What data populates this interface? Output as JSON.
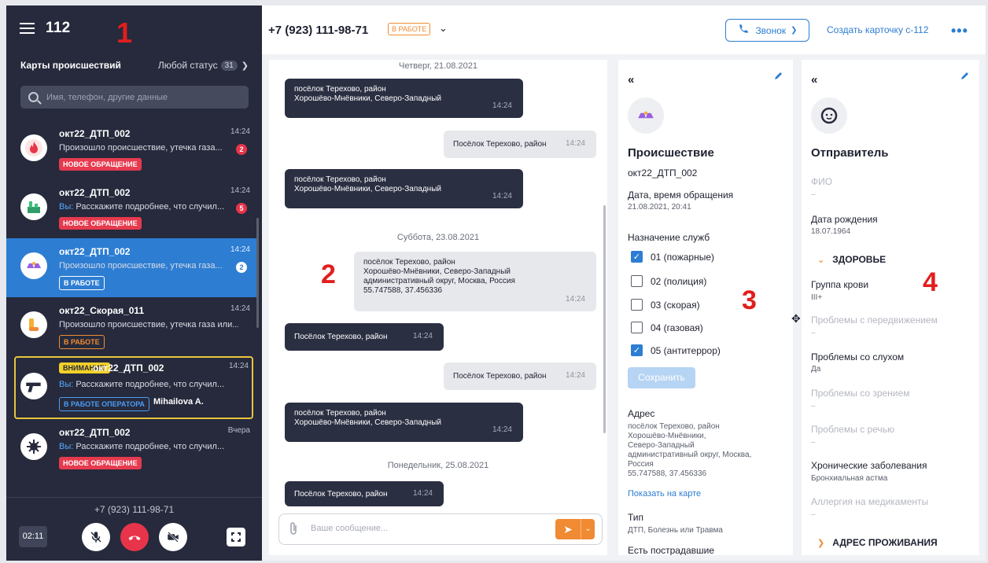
{
  "sidebar": {
    "title": "112",
    "list_title": "Карты происшествий",
    "status_filter": "Любой статус",
    "status_count": "31",
    "search_placeholder": "Имя, телефон, другие данные",
    "incidents": [
      {
        "name": "окт22_ДТП_002",
        "time": "14:24",
        "you": "",
        "message": "Произошло происшествие, утечка газа...",
        "unread": "2",
        "badge": "НОВОЕ ОБРАЩЕНИЕ",
        "icon": "fire-icon"
      },
      {
        "name": "окт22_ДТП_002",
        "time": "14:24",
        "you": "Вы:",
        "message": " Расскажите подробнее, что случил...",
        "unread": "5",
        "badge": "НОВОЕ ОБРАЩЕНИЕ",
        "icon": "industry-icon"
      },
      {
        "name": "окт22_ДТП_002",
        "time": "14:24",
        "you": "",
        "message": "Произошло происшествие, утечка газа...",
        "unread": "2",
        "badge": "В РАБОТЕ",
        "icon": "car-crash-icon"
      },
      {
        "name": "окт22_Скорая_011",
        "time": "14:24",
        "you": "",
        "message": "Произошло происшествие, утечка газа или...",
        "unread": "",
        "badge": "В РАБОТЕ",
        "icon": "injury-icon"
      },
      {
        "name": "окт22_ДТП_002",
        "time": "14:24",
        "attention": "ВНИМАНИЕ!",
        "you": "Вы:",
        "message": " Расскажите подробнее, что случил...",
        "unread": "",
        "badge": "В РАБОТЕ ОПЕРАТОРА",
        "operator": "Mihailova A.",
        "icon": "gun-icon"
      },
      {
        "name": "окт22_ДТП_002",
        "time": "Вчера",
        "you": "Вы:",
        "message": " Расскажите подробнее, что случил...",
        "unread": "",
        "badge": "НОВОЕ ОБРАЩЕНИЕ",
        "icon": "virus-icon"
      }
    ],
    "call": {
      "number": "+7 (923) 111-98-71",
      "duration": "02:11"
    }
  },
  "topbar": {
    "phone": "+7 (923) 111-98-71",
    "status": "В РАБОТЕ",
    "call_button": "Звонок",
    "create_card": "Создать карточку с-112",
    "more": "•••"
  },
  "chat": {
    "dates": [
      "Четверг, 21.08.2021",
      "Суббота, 23.08.2021",
      "Понедельник, 25.08.2021"
    ],
    "messages": [
      {
        "text1": "посёлок Терехово, район",
        "text2": "Хорошёво-Мнёвники, Северо-Западный",
        "time": "14:24"
      },
      {
        "text1": "Посёлок Терехово, район",
        "time": "14:24"
      },
      {
        "text1": "посёлок Терехово, район",
        "text2": "Хорошёво-Мнёвники, Северо-Западный",
        "time": "14:24"
      },
      {
        "text1": "посёлок Терехово, район",
        "text2": "Хорошёво-Мнёвники, Северо-Западный",
        "text3": "административный округ, Москва, Россия",
        "text4": "55.747588, 37.456336",
        "time": "14:24"
      },
      {
        "text1": "Посёлок Терехово, район",
        "time": "14:24"
      },
      {
        "text1": "Посёлок Терехово, район",
        "time": "14:24"
      },
      {
        "text1": "посёлок Терехово, район",
        "text2": "Хорошёво-Мнёвники, Северо-Западный",
        "time": "14:24"
      },
      {
        "text1": "Посёлок Терехово, район",
        "time": "14:24"
      }
    ],
    "input_placeholder": "Ваше сообщение..."
  },
  "annotations": [
    "1",
    "2",
    "3",
    "4"
  ],
  "incident_panel": {
    "title": "Происшествие",
    "code": "окт22_ДТП_002",
    "date_label": "Дата, время обращения",
    "date_value": "21.08.2021, 20:41",
    "services_label": "Назначение служб",
    "services": [
      {
        "label": "01 (пожарные)",
        "checked": true
      },
      {
        "label": "02 (полиция)",
        "checked": false
      },
      {
        "label": "03 (скорая)",
        "checked": false
      },
      {
        "label": "04 (газовая)",
        "checked": false
      },
      {
        "label": "05 (антитеррор)",
        "checked": true
      }
    ],
    "save": "Сохранить",
    "address_label": "Адрес",
    "address_lines": [
      "посёлок Терехово, район",
      "Хорошёво-Мнёвники,",
      "Северо-Западный",
      "административный округ, Москва,",
      "Россия",
      "55.747588, 37.456336"
    ],
    "map_link": "Показать на карте",
    "type_label": "Тип",
    "type_value": "ДТП, Болезнь или Травма",
    "victims_label": "Есть пострадавшие"
  },
  "sender_panel": {
    "title": "Отправитель",
    "fio_label": "ФИО",
    "fio_value": "–",
    "birth_label": "Дата рождения",
    "birth_value": "18.07.1964",
    "health_section": "ЗДОРОВЬЕ",
    "blood_label": "Группа крови",
    "blood_value": "III+",
    "mobility_label": "Проблемы с передвижением",
    "mobility_value": "–",
    "hearing_label": "Проблемы со слухом",
    "hearing_value": "Да",
    "vision_label": "Проблемы со зрением",
    "vision_value": "–",
    "speech_label": "Проблемы с речью",
    "speech_value": "–",
    "chronic_label": "Хронические заболевания",
    "chronic_value": "Бронхиальная астма",
    "allergy_label": "Аллергия на медикаменты",
    "allergy_value": "–",
    "address_section": "АДРЕС ПРОЖИВАНИЯ"
  }
}
